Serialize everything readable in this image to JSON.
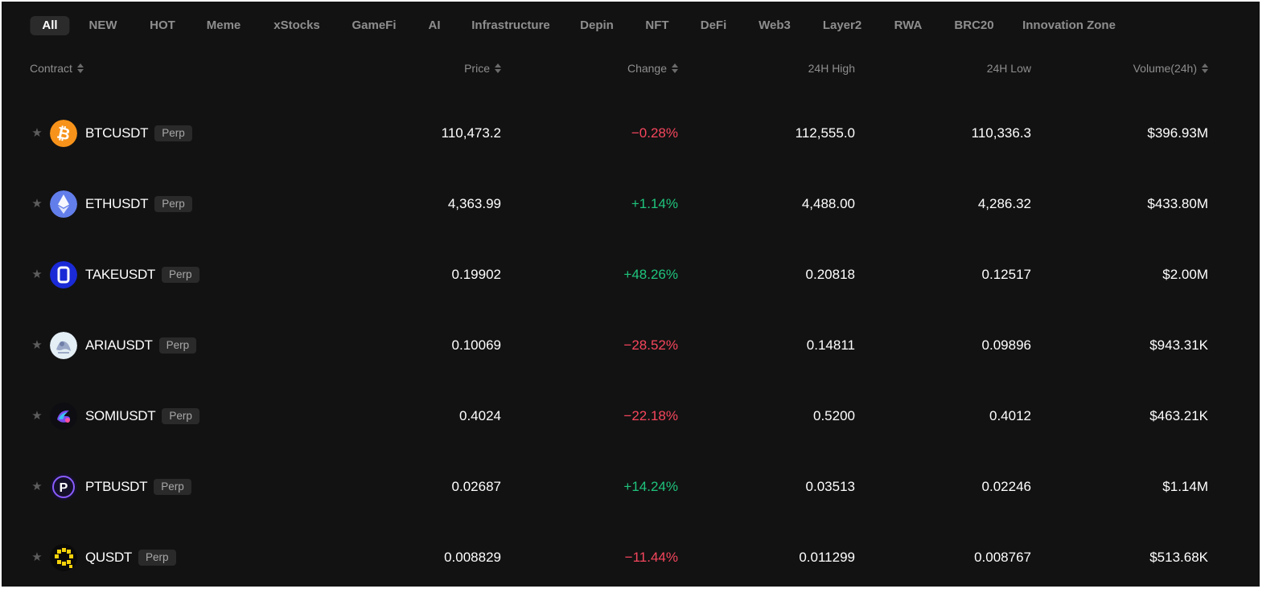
{
  "tabs": [
    "All",
    "NEW",
    "HOT",
    "Meme",
    "xStocks",
    "GameFi",
    "AI",
    "Infrastructure",
    "Depin",
    "NFT",
    "DeFi",
    "Web3",
    "Layer2",
    "RWA",
    "BRC20",
    "Innovation Zone"
  ],
  "headers": {
    "contract": "Contract",
    "price": "Price",
    "change": "Change",
    "high": "24H High",
    "low": "24H Low",
    "volume": "Volume(24h)"
  },
  "rows": [
    {
      "symbol": "BTCUSDT",
      "tag": "Perp",
      "price": "110,473.2",
      "change": "−0.28%",
      "high": "112,555.0",
      "low": "110,336.3",
      "volume": "$396.93M",
      "icon": "bitcoin-icon"
    },
    {
      "symbol": "ETHUSDT",
      "tag": "Perp",
      "price": "4,363.99",
      "change": "+1.14%",
      "high": "4,488.00",
      "low": "4,286.32",
      "volume": "$433.80M",
      "icon": "ethereum-icon"
    },
    {
      "symbol": "TAKEUSDT",
      "tag": "Perp",
      "price": "0.19902",
      "change": "+48.26%",
      "high": "0.20818",
      "low": "0.12517",
      "volume": "$2.00M",
      "icon": "take-icon"
    },
    {
      "symbol": "ARIAUSDT",
      "tag": "Perp",
      "price": "0.10069",
      "change": "−28.52%",
      "high": "0.14811",
      "low": "0.09896",
      "volume": "$943.31K",
      "icon": "aria-icon"
    },
    {
      "symbol": "SOMIUSDT",
      "tag": "Perp",
      "price": "0.4024",
      "change": "−22.18%",
      "high": "0.5200",
      "low": "0.4012",
      "volume": "$463.21K",
      "icon": "somi-icon"
    },
    {
      "symbol": "PTBUSDT",
      "tag": "Perp",
      "price": "0.02687",
      "change": "+14.24%",
      "high": "0.03513",
      "low": "0.02246",
      "volume": "$1.14M",
      "icon": "ptb-icon"
    },
    {
      "symbol": "QUSDT",
      "tag": "Perp",
      "price": "0.008829",
      "change": "−11.44%",
      "high": "0.011299",
      "low": "0.008767",
      "volume": "$513.68K",
      "icon": "q-icon"
    }
  ],
  "colors": {
    "up": "#1fc47d",
    "down": "#f6465d",
    "background": "#121212"
  }
}
